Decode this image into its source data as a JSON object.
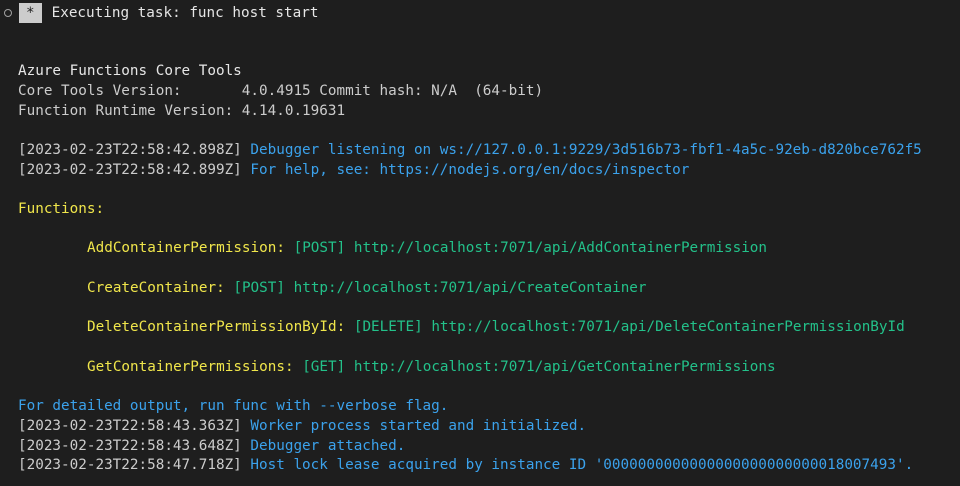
{
  "task_header": {
    "star": "*",
    "text": "Executing task: func host start"
  },
  "banner": {
    "title": "Azure Functions Core Tools",
    "core_tools_label": "Core Tools Version:       ",
    "core_tools_value": "4.0.4915 Commit hash: N/A  (64-bit)",
    "runtime_label": "Function Runtime Version: ",
    "runtime_value": "4.14.0.19631"
  },
  "debug_lines": [
    {
      "timestamp": "[2023-02-23T22:58:42.898Z] ",
      "message": "Debugger listening on ws://127.0.0.1:9229/3d516b73-fbf1-4a5c-92eb-d820bce762f5"
    },
    {
      "timestamp": "[2023-02-23T22:58:42.899Z] ",
      "message": "For help, see: https://nodejs.org/en/docs/inspector"
    }
  ],
  "functions_heading": "Functions:",
  "functions": [
    {
      "name": "AddContainerPermission:",
      "method": "[POST]",
      "url": "http://localhost:7071/api/AddContainerPermission"
    },
    {
      "name": "CreateContainer:",
      "method": "[POST]",
      "url": "http://localhost:7071/api/CreateContainer"
    },
    {
      "name": "DeleteContainerPermissionById:",
      "method": "[DELETE]",
      "url": "http://localhost:7071/api/DeleteContainerPermissionById"
    },
    {
      "name": "GetContainerPermissions:",
      "method": "[GET]",
      "url": "http://localhost:7071/api/GetContainerPermissions"
    }
  ],
  "verbose_hint": "For detailed output, run func with --verbose flag.",
  "log_lines": [
    {
      "timestamp": "[2023-02-23T22:58:43.363Z] ",
      "message": "Worker process started and initialized."
    },
    {
      "timestamp": "[2023-02-23T22:58:43.648Z] ",
      "message": "Debugger attached."
    },
    {
      "timestamp": "[2023-02-23T22:58:47.718Z] ",
      "message": "Host lock lease acquired by instance ID '0000000000000000000000000018007493'."
    }
  ],
  "colors": {
    "background": "#1e1e1e",
    "timestamp": "#cccccc",
    "info_blue": "#3ba2ec",
    "function_yellow": "#f0e64b",
    "url_green": "#23c18a"
  }
}
